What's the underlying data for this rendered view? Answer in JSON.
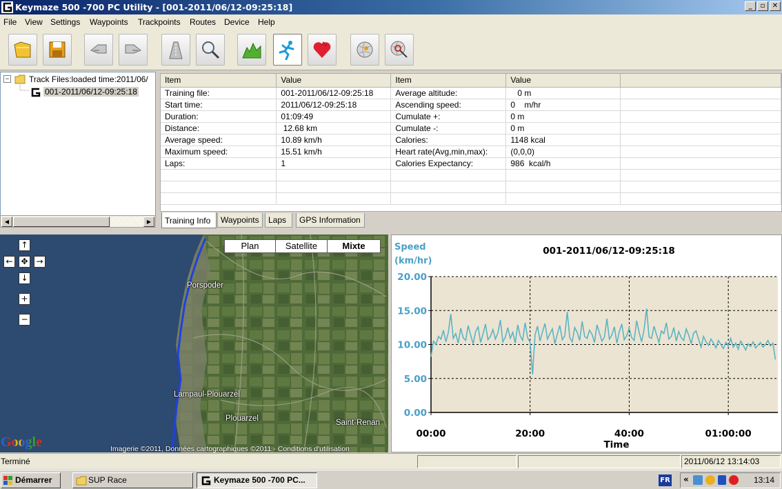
{
  "window": {
    "title": "Keymaze 500 -700 PC Utility - [001-2011/06/12-09:25:18]"
  },
  "menu": [
    "File",
    "View",
    "Settings",
    "Waypoints",
    "Trackpoints",
    "Routes",
    "Device",
    "Help"
  ],
  "toolbar": {
    "buttons": [
      "open-icon",
      "save-icon",
      "download-icon",
      "upload-icon",
      "route-icon",
      "zoom-icon",
      "altitude-icon",
      "runner-icon",
      "heart-icon",
      "globe-icon",
      "globe-search-icon"
    ],
    "active": "runner-icon"
  },
  "tree": {
    "root_label": "Track Files:loaded time:2011/06/",
    "child_label": "001-2011/06/12-09:25:18"
  },
  "grid": {
    "headers": [
      "Item",
      "Value",
      "Item",
      "Value"
    ],
    "rows": [
      [
        "Training file:",
        "001-2011/06/12-09:25:18",
        "Average altitude:",
        "   0 m"
      ],
      [
        "Start time:",
        "2011/06/12-09:25:18",
        "Ascending speed:",
        "0    m/hr"
      ],
      [
        "Duration:",
        "01:09:49",
        "Cumulate +:",
        "0 m"
      ],
      [
        "Distance:",
        " 12.68 km",
        "Cumulate -:",
        "0 m"
      ],
      [
        "Average speed:",
        "10.89 km/h",
        "Calories:",
        "1148 kcal"
      ],
      [
        "Maximum speed:",
        "15.51 km/h",
        "Heart rate(Avg,min,max):",
        "(0,0,0)"
      ],
      [
        "Laps:",
        "1",
        "Calories Expectancy:",
        "986  kcal/h"
      ],
      [
        "",
        "",
        "",
        ""
      ],
      [
        "",
        "",
        "",
        ""
      ],
      [
        "",
        "",
        "",
        ""
      ]
    ]
  },
  "tabs": [
    "Training Info",
    "Waypoints",
    "Laps",
    "GPS Information"
  ],
  "active_tab": "Training Info",
  "map": {
    "types": [
      "Plan",
      "Satellite",
      "Mixte"
    ],
    "places": [
      "Porspoder",
      "Lampaul-Plouarzel",
      "Plouarzel",
      "Saint-Renan"
    ],
    "copyright": "Imagerie ©2011, Données cartographiques ©2011 - Conditions d'utilisation",
    "logo": "Google"
  },
  "chart_data": {
    "type": "line",
    "title": "001-2011/06/12-09:25:18",
    "ylabel": "Speed\n(km/hr)",
    "ylabel_lines": [
      "Speed",
      "(km/hr)"
    ],
    "xlabel": "Time",
    "ylim": [
      0,
      20
    ],
    "y_ticks": [
      "0.00",
      "5.00",
      "10.00",
      "15.00",
      "20.00"
    ],
    "x_ticks": [
      "00:00",
      "20:00",
      "40:00",
      "01:00:00"
    ],
    "xlim_minutes": [
      0,
      70
    ],
    "grid": true,
    "background": "#ece4d2",
    "line_color": "#5ab4c4",
    "series": [
      {
        "x_minutes": [
          0,
          0.5,
          1,
          1.5,
          2,
          2.5,
          3,
          3.5,
          4,
          4.5,
          5,
          5.5,
          6,
          6.5,
          7,
          7.5,
          8,
          8.5,
          9,
          9.5,
          10,
          10.5,
          11,
          11.5,
          12,
          12.5,
          13,
          13.5,
          14,
          14.5,
          15,
          15.5,
          16,
          16.5,
          17,
          17.5,
          18,
          18.5,
          19,
          19.5,
          20,
          20.5,
          21,
          21.5,
          22,
          22.5,
          23,
          23.5,
          24,
          24.5,
          25,
          25.5,
          26,
          26.5,
          27,
          27.5,
          28,
          28.5,
          29,
          29.5,
          30,
          30.5,
          31,
          31.5,
          32,
          32.5,
          33,
          33.5,
          34,
          34.5,
          35,
          35.5,
          36,
          36.5,
          37,
          37.5,
          38,
          38.5,
          39,
          39.5,
          40,
          40.5,
          41,
          41.5,
          42,
          42.5,
          43,
          43.5,
          44,
          44.5,
          45,
          45.5,
          46,
          46.5,
          47,
          47.5,
          48,
          48.5,
          49,
          49.5,
          50,
          50.5,
          51,
          51.5,
          52,
          52.5,
          53,
          53.5,
          54,
          54.5,
          55,
          55.5,
          56,
          56.5,
          57,
          57.5,
          58,
          58.5,
          59,
          59.5,
          60,
          60.5,
          61,
          61.5,
          62,
          62.5,
          63,
          63.5,
          64,
          64.5,
          65,
          65.5,
          66,
          66.5,
          67,
          67.5,
          68,
          68.5,
          69,
          69.5
        ],
        "values": [
          8.2,
          10.5,
          10.0,
          11.2,
          10.8,
          12.1,
          10.4,
          11.8,
          14.5,
          10.9,
          11.6,
          10.2,
          12.4,
          11.0,
          10.6,
          12.8,
          11.4,
          10.1,
          11.9,
          12.6,
          10.3,
          11.5,
          13.0,
          10.7,
          11.2,
          12.2,
          10.8,
          11.7,
          13.6,
          10.4,
          11.1,
          12.5,
          10.9,
          11.8,
          10.2,
          12.9,
          11.3,
          10.6,
          13.2,
          11.0,
          10.3,
          5.6,
          11.4,
          12.7,
          10.5,
          11.9,
          13.1,
          10.8,
          11.6,
          12.3,
          10.1,
          11.5,
          12.8,
          10.7,
          11.3,
          14.8,
          11.0,
          10.4,
          12.5,
          11.8,
          10.6,
          13.4,
          11.2,
          10.9,
          12.1,
          11.5,
          10.3,
          12.9,
          11.7,
          10.5,
          11.1,
          13.8,
          10.8,
          11.4,
          12.6,
          10.2,
          11.9,
          13.0,
          10.7,
          11.3,
          12.4,
          11.0,
          10.6,
          13.5,
          11.8,
          10.4,
          12.2,
          15.3,
          11.1,
          10.9,
          12.7,
          11.5,
          10.3,
          12.0,
          11.6,
          13.2,
          10.8,
          11.2,
          12.5,
          10.5,
          11.9,
          11.0,
          10.6,
          12.3,
          11.4,
          10.1,
          11.7,
          12.0,
          10.8,
          9.6,
          11.2,
          10.4,
          9.9,
          10.8,
          10.2,
          9.5,
          10.6,
          10.0,
          9.4,
          10.3,
          9.8,
          10.9,
          9.6,
          10.2,
          9.3,
          10.5,
          9.9,
          9.2,
          10.1,
          9.7,
          10.4,
          9.5,
          9.9,
          10.3,
          9.6,
          10.0,
          10.6,
          9.8,
          10.2,
          7.8
        ]
      }
    ]
  },
  "status": {
    "text": "Terminé",
    "datetime": "2011/06/12 13:14:03"
  },
  "taskbar": {
    "start": "Démarrer",
    "items": [
      "SUP Race",
      "Keymaze 500 -700 PC..."
    ],
    "lang": "FR",
    "clock": "13:14"
  }
}
